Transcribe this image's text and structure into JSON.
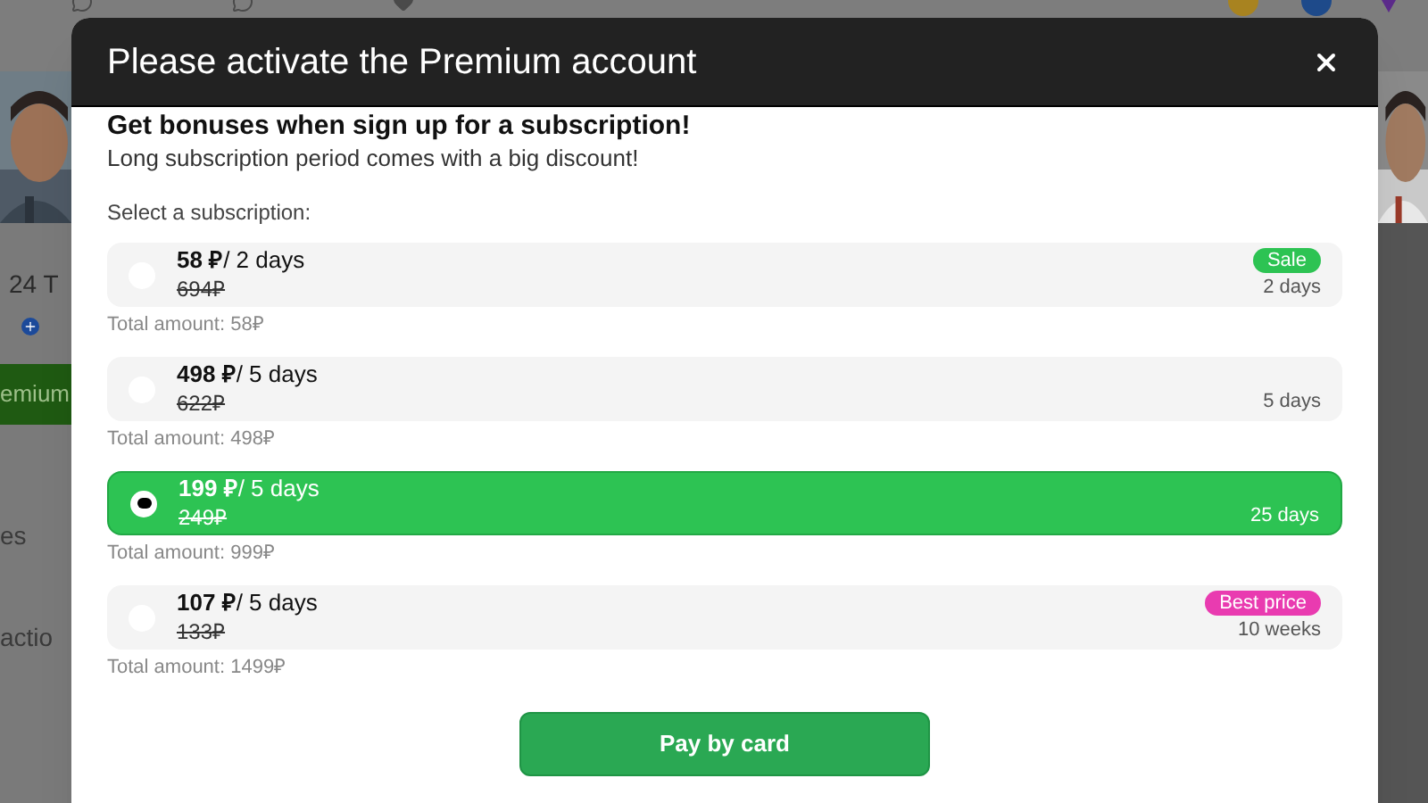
{
  "background_page": {
    "profile_stats": "24 T",
    "premium_button": "emium",
    "menu_items": [
      "es",
      "actio"
    ]
  },
  "modal": {
    "title": "Please activate the Premium account",
    "heading": "Get bonuses when sign up for a subscription!",
    "subheading": "Long subscription period comes with a big discount!",
    "select_label": "Select a subscription:",
    "options": [
      {
        "price": "58 ₽",
        "period": "/ 2 days",
        "old_price": "694₽",
        "duration": "2 days",
        "badge": {
          "text": "Sale",
          "color": "#2dc353"
        },
        "total": "Total amount: 58₽",
        "selected": false
      },
      {
        "price": "498 ₽",
        "period": "/ 5 days",
        "old_price": "622₽",
        "duration": "5 days",
        "total": "Total amount: 498₽",
        "selected": false
      },
      {
        "price": "199 ₽",
        "period": "/ 5 days",
        "old_price": "249₽",
        "duration": "25 days",
        "total": "Total amount: 999₽",
        "selected": true
      },
      {
        "price": "107 ₽",
        "period": "/ 5 days",
        "old_price": "133₽",
        "duration": "10 weeks",
        "badge": {
          "text": "Best price",
          "color": "#e93bb0"
        },
        "total": "Total amount: 1499₽",
        "selected": false
      }
    ],
    "pay_button": "Pay by card"
  }
}
